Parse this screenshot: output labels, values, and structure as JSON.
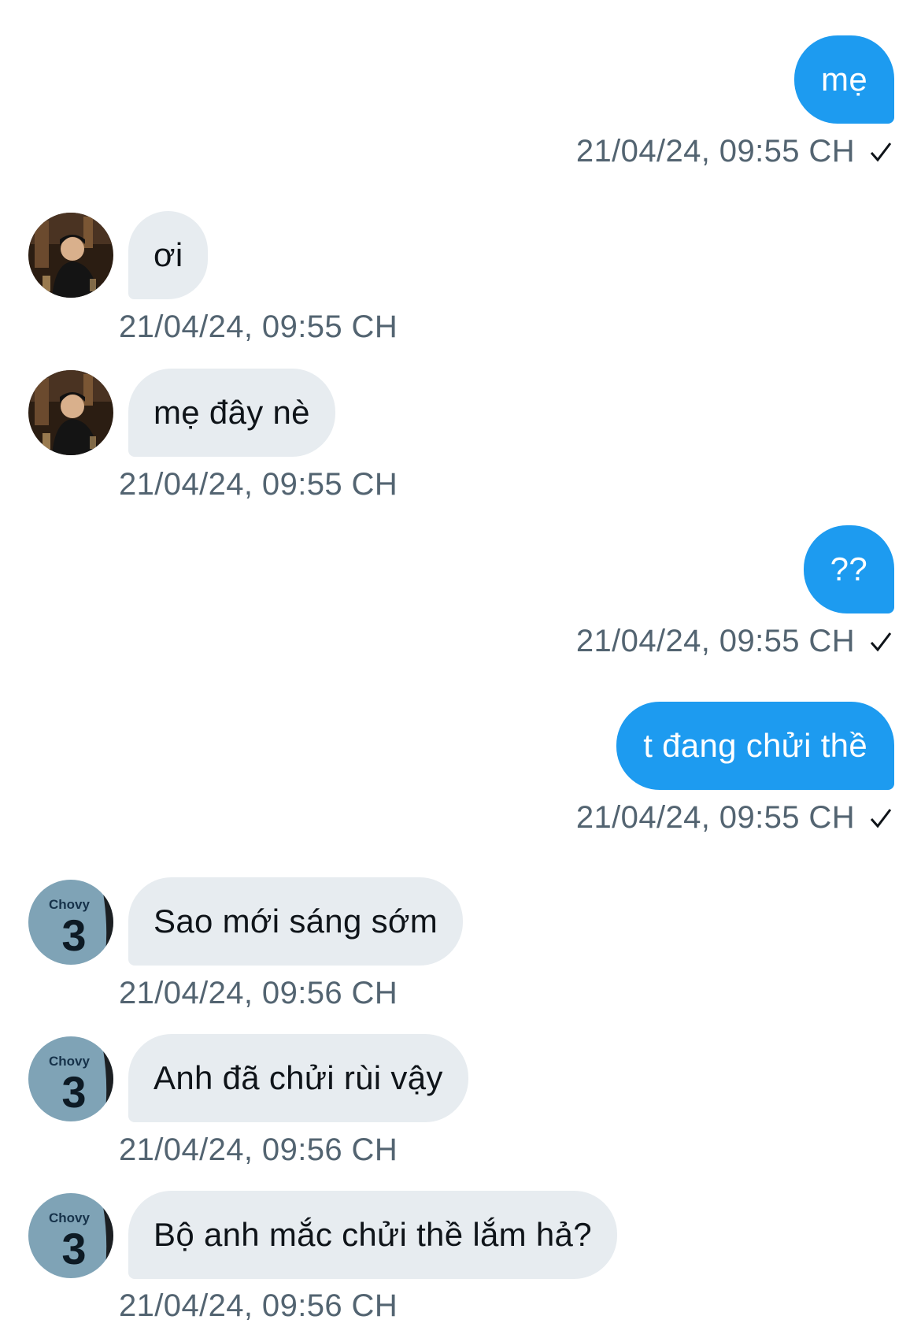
{
  "conversation": {
    "messages": [
      {
        "direction": "out",
        "text": "mẹ",
        "timestamp": "21/04/24, 09:55 CH",
        "status": "check-icon"
      },
      {
        "direction": "in",
        "text": "ơi",
        "timestamp": "21/04/24, 09:55 CH",
        "avatar": "photo-avatar"
      },
      {
        "direction": "in",
        "text": "mẹ đây nè",
        "timestamp": "21/04/24, 09:55 CH",
        "avatar": "photo-avatar"
      },
      {
        "direction": "out",
        "text": "??",
        "timestamp": "21/04/24, 09:55 CH",
        "status": "check-icon"
      },
      {
        "direction": "out",
        "text": "t đang chửi thề",
        "timestamp": "21/04/24, 09:55 CH",
        "status": "check-icon"
      },
      {
        "direction": "in",
        "text": "Sao mới sáng sớm",
        "timestamp": "21/04/24, 09:56 CH",
        "avatar": "jersey-avatar"
      },
      {
        "direction": "in",
        "text": "Anh đã chửi rùi vậy",
        "timestamp": "21/04/24, 09:56 CH",
        "avatar": "jersey-avatar"
      },
      {
        "direction": "in",
        "text": "Bộ anh mắc chửi thề lắm hả?",
        "timestamp": "21/04/24, 09:56 CH",
        "avatar": "jersey-avatar"
      }
    ]
  },
  "avatars": {
    "jersey": {
      "name_text": "Chovy",
      "number_text": "3"
    }
  },
  "colors": {
    "outgoing_bubble": "#1d9bf0",
    "incoming_bubble": "#e7ecf0",
    "timestamp": "#536471",
    "background": "#ffffff"
  }
}
